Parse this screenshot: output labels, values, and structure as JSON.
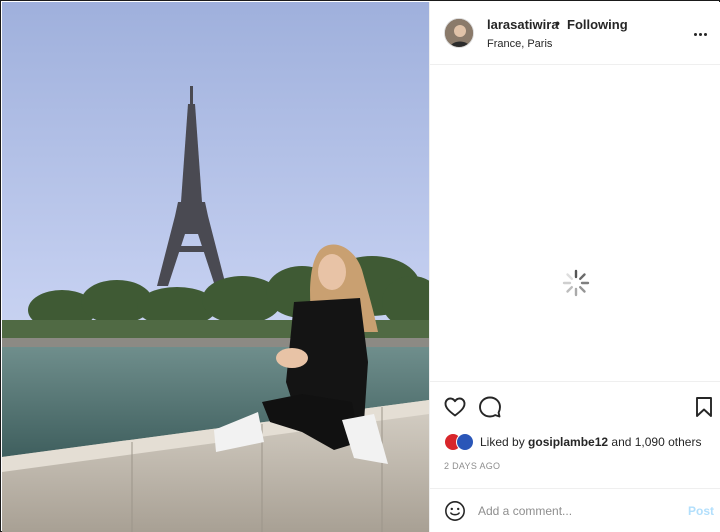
{
  "post": {
    "username": "larasatiwira",
    "separator": "•",
    "follow_label": "Following",
    "location": "France, Paris",
    "likes_prefix": "Liked by ",
    "liked_by_user": "gosiplambe12",
    "likes_suffix": " and 1,090 others",
    "date": "2 DAYS AGO",
    "comment_placeholder": "Add a comment...",
    "post_label": "Post"
  },
  "colors": {
    "text": "#262626",
    "muted": "#8e8e8e",
    "post_disabled": "#b2dffc",
    "divider": "#efefef"
  },
  "icons": [
    "more-options-icon",
    "loading-spinner-icon",
    "heart-icon",
    "comment-icon",
    "bookmark-icon",
    "emoji-icon"
  ]
}
